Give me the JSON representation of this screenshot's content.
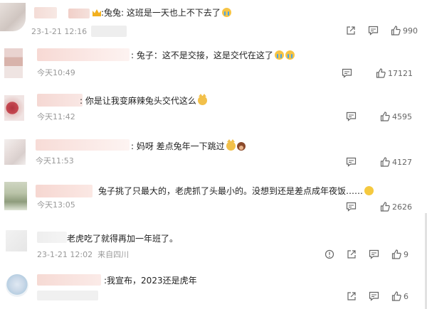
{
  "comments": [
    {
      "prefix": ":兔兔: ",
      "text": "这班是一天也上不下去了",
      "emoji": "cry",
      "time": "23-1-21 12:16",
      "location": "",
      "likes": "990",
      "has_crown": true
    },
    {
      "prefix": ": ",
      "text": "兔子：这不是交接，这是交代在这了",
      "emoji": "cry2",
      "time": "今天10:49",
      "location": "",
      "likes": "17121",
      "has_crown": false
    },
    {
      "prefix": ": ",
      "text": "你是让我变麻辣兔头交代这么",
      "emoji": "cat",
      "time": "今天11:42",
      "location": "",
      "likes": "4595",
      "has_crown": false
    },
    {
      "prefix": ": ",
      "text": "妈呀 差点兔年一下跳过",
      "emoji": "cat-person",
      "time": "今天11:53",
      "location": "",
      "likes": "4127",
      "has_crown": false
    },
    {
      "prefix": "",
      "text": "兔子挑了只最大的，老虎抓了头最小的。没想到还是差点成年夜饭……",
      "emoji": "laugh",
      "time": "今天13:05",
      "location": "",
      "likes": "2626",
      "has_crown": false
    },
    {
      "prefix": "",
      "text": "老虎吃了就得再加一年班了。",
      "emoji": "",
      "time": "23-1-21 12:02",
      "location": "来自四川",
      "likes": "9",
      "has_crown": false
    },
    {
      "prefix": ":",
      "text": "我宣布，2023还是虎年",
      "emoji": "",
      "time": "",
      "location": "",
      "likes": "6",
      "has_crown": false
    }
  ],
  "icons": {
    "share": "share-icon",
    "reply": "comment-icon",
    "like": "thumbs-up-icon",
    "report": "report-icon"
  }
}
